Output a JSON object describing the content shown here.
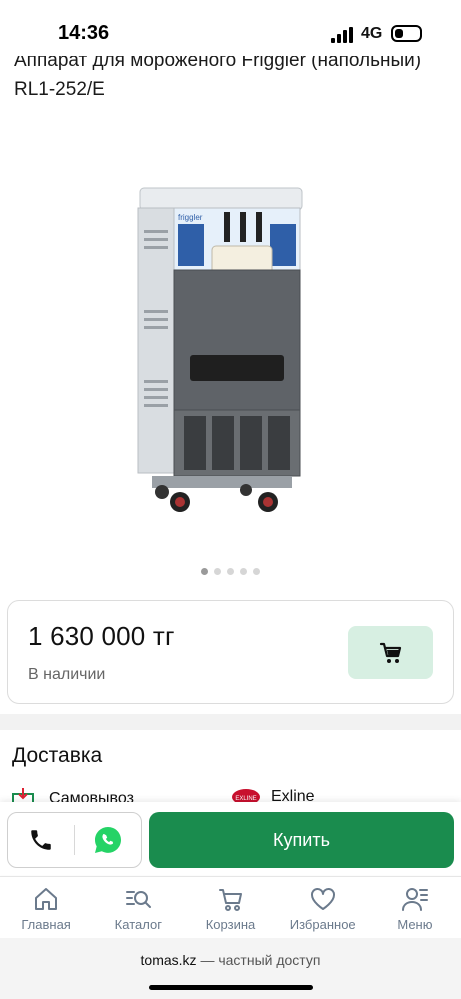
{
  "status_bar": {
    "time": "14:36",
    "network": "4G",
    "battery_level": 0.35
  },
  "product": {
    "title": "Аппарат для мороженого Friggler (напольный) RL1-252/E",
    "image_brand_text": "friggler",
    "gallery": {
      "total_images": 5,
      "active_index": 0
    }
  },
  "price_card": {
    "price": "1 630 000 тг",
    "availability": "В наличии",
    "cart_icon": "cart-icon"
  },
  "delivery": {
    "title": "Доставка",
    "options": [
      {
        "label": "Самовывоз",
        "icon": "pickup-icon"
      },
      {
        "label": "Exline",
        "icon": "exline-logo",
        "logo_text": "EXLINE"
      }
    ]
  },
  "action_bar": {
    "call_icon": "phone-icon",
    "whatsapp_icon": "whatsapp-icon",
    "buy_label": "Купить"
  },
  "tab_bar": {
    "items": [
      {
        "label": "Главная",
        "icon": "home-icon"
      },
      {
        "label": "Каталог",
        "icon": "catalog-search-icon"
      },
      {
        "label": "Корзина",
        "icon": "cart-icon"
      },
      {
        "label": "Избранное",
        "icon": "heart-icon"
      },
      {
        "label": "Меню",
        "icon": "user-menu-icon"
      }
    ]
  },
  "browser": {
    "domain": "tomas.kz",
    "suffix": " — частный доступ"
  },
  "colors": {
    "accent": "#1a8c4e",
    "cart_button_bg": "#d7efe2",
    "tab_gray": "#6b7a8c"
  }
}
